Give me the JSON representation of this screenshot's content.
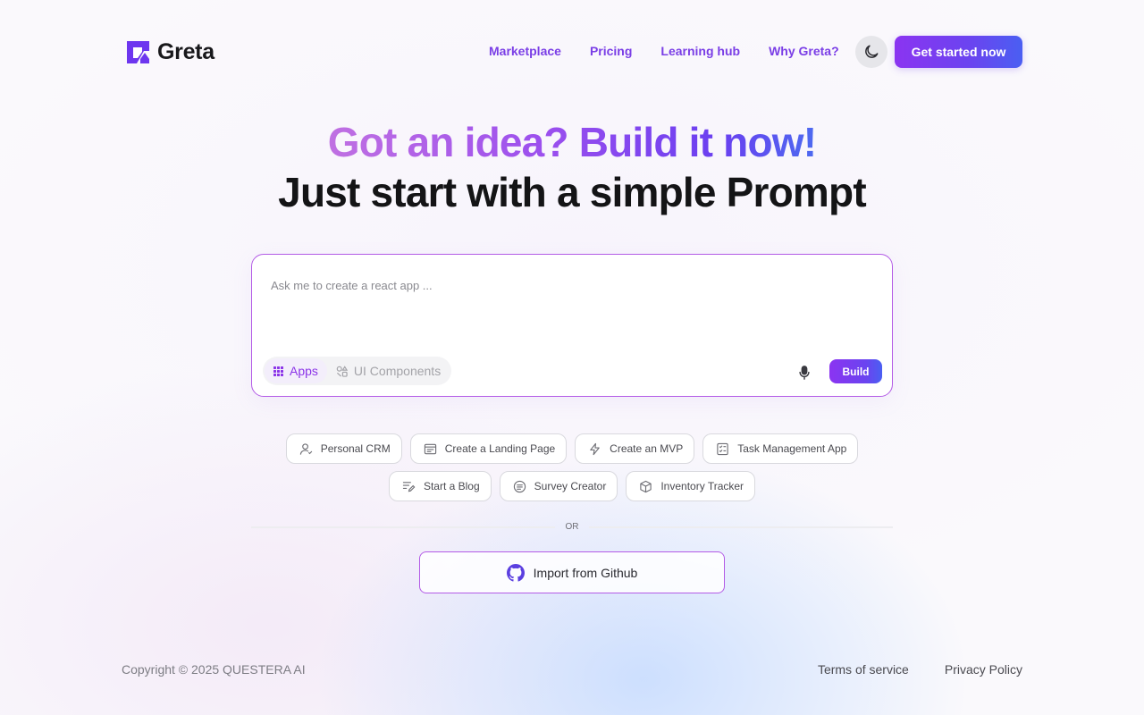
{
  "brand": {
    "name": "Greta",
    "accent": "#7a3ee6"
  },
  "nav": {
    "links": [
      "Marketplace",
      "Pricing",
      "Learning hub",
      "Why Greta?"
    ],
    "theme_toggle_icon": "moon-icon",
    "cta_label": "Get started now"
  },
  "hero": {
    "headline": "Got an idea? Build it now!",
    "subheadline": "Just start with a simple Prompt"
  },
  "prompt": {
    "placeholder": "Ask me to create a react app ...",
    "value": "",
    "modes": [
      {
        "label": "Apps",
        "icon": "grid-icon",
        "active": true
      },
      {
        "label": "UI Components",
        "icon": "shapes-icon",
        "active": false
      }
    ],
    "mic_icon": "microphone-icon",
    "build_label": "Build"
  },
  "suggestions": {
    "row1": [
      {
        "label": "Personal CRM",
        "icon": "user-icon"
      },
      {
        "label": "Create a Landing Page",
        "icon": "browser-icon"
      },
      {
        "label": "Create an MVP",
        "icon": "lightning-icon"
      },
      {
        "label": "Task Management App",
        "icon": "checklist-icon"
      }
    ],
    "row2": [
      {
        "label": "Start a Blog",
        "icon": "edit-icon"
      },
      {
        "label": "Survey Creator",
        "icon": "survey-icon"
      },
      {
        "label": "Inventory Tracker",
        "icon": "box-icon"
      }
    ]
  },
  "divider_label": "OR",
  "import": {
    "label": "Import from Github",
    "icon": "github-icon"
  },
  "footer": {
    "copyright": "Copyright © 2025 QUESTERA AI",
    "links": [
      "Terms of service",
      "Privacy Policy"
    ]
  }
}
